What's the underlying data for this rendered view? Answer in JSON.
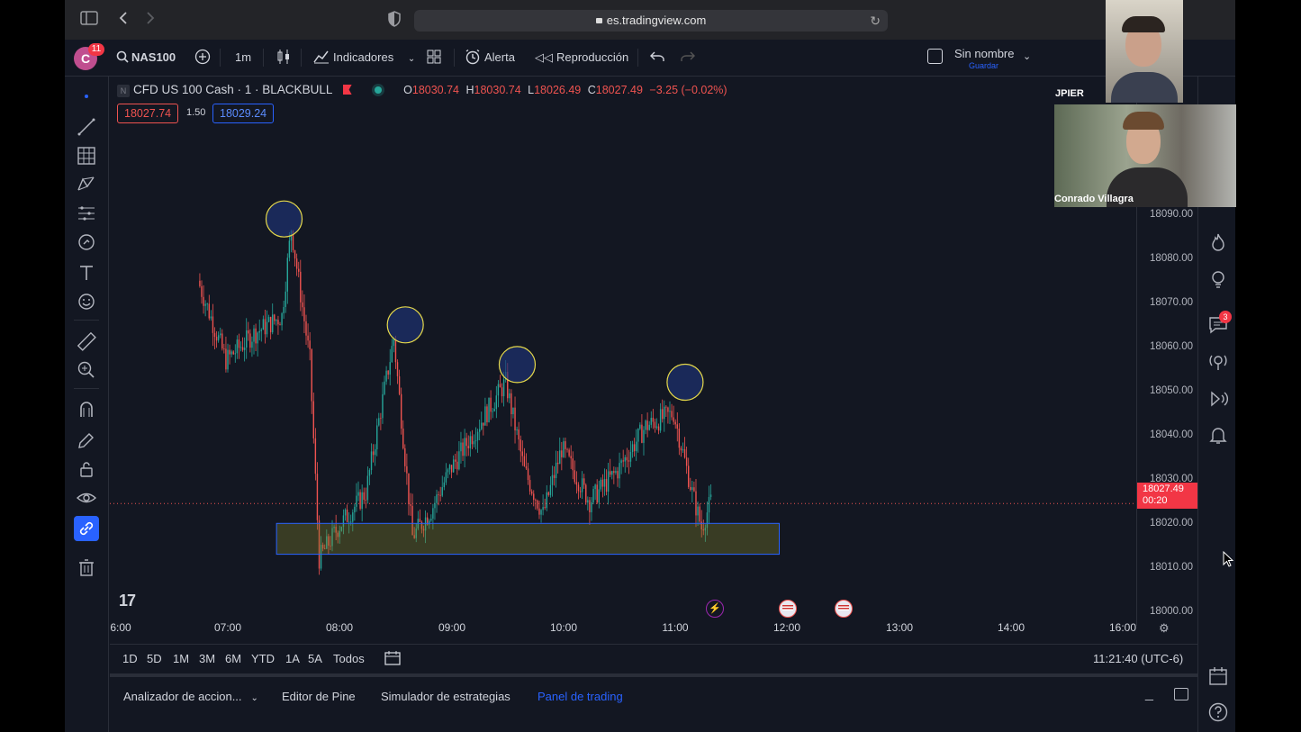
{
  "browser": {
    "url": "es.tradingview.com"
  },
  "toolbar": {
    "avatar_letter": "C",
    "notifications": "11",
    "symbol": "NAS100",
    "interval": "1m",
    "indicators_label": "Indicadores",
    "alert_label": "Alerta",
    "replay_label": "Reproducción",
    "layout_name": "Sin nombre",
    "layout_save": "Guardar"
  },
  "legend": {
    "title": "CFD US 100 Cash · 1 · BLACKBULL",
    "o_label": "O",
    "o_value": "18030.74",
    "h_label": "H",
    "h_value": "18030.74",
    "l_label": "L",
    "l_value": "18026.49",
    "c_label": "C",
    "c_value": "18027.49",
    "change": "−3.25 (−0.02%)",
    "sell_price": "18027.74",
    "spread": "1.50",
    "buy_price": "18029.24"
  },
  "price_scale": {
    "labels": [
      "18090.00",
      "18080.00",
      "18070.00",
      "18060.00",
      "18050.00",
      "18040.00",
      "18030.00",
      "18020.00",
      "18010.00",
      "18000.00"
    ],
    "current_price": "18027.49",
    "countdown": "00:20"
  },
  "time_scale": {
    "labels": [
      "6:00",
      "07:00",
      "08:00",
      "09:00",
      "10:00",
      "11:00",
      "12:00",
      "13:00",
      "14:00",
      "16:00"
    ]
  },
  "range_bar": {
    "ranges": [
      "1D",
      "5D",
      "1M",
      "3M",
      "6M",
      "YTD",
      "1A",
      "5A",
      "Todos"
    ],
    "clock": "11:21:40 (UTC-6)"
  },
  "bottom_panel": {
    "tabs": [
      "Analizador de accion...",
      "Editor de Pine",
      "Simulador de estrategias",
      "Panel de trading"
    ]
  },
  "right_sidebar": {
    "chat_badge": "3"
  },
  "video": {
    "participant1": "JPIER",
    "participant2": "Conrado Villagra"
  },
  "colors": {
    "up": "#26a69a",
    "down": "#ef5350",
    "accent": "#2962ff",
    "background": "#131722"
  },
  "chart_data": {
    "type": "candlestick",
    "symbol": "CFD US 100 Cash",
    "interval": "1m",
    "ylim": [
      18000,
      18100
    ],
    "x": [
      "06:45",
      "07:00",
      "07:15",
      "07:30",
      "07:35",
      "07:45",
      "07:50",
      "08:00",
      "08:15",
      "08:30",
      "08:40",
      "08:50",
      "09:00",
      "09:15",
      "09:30",
      "09:40",
      "09:50",
      "10:00",
      "10:15",
      "10:30",
      "10:45",
      "11:00",
      "11:10",
      "11:15",
      "11:20"
    ],
    "close": [
      18078,
      18060,
      18066,
      18070,
      18090,
      18060,
      18015,
      18022,
      18030,
      18065,
      18020,
      18026,
      18035,
      18045,
      18055,
      18035,
      18025,
      18040,
      18028,
      18035,
      18045,
      18048,
      18030,
      18022,
      18028
    ],
    "annotations": {
      "swing_highs": [
        18092,
        18068,
        18059,
        18055
      ],
      "support_zone": [
        18016,
        18023
      ]
    }
  }
}
